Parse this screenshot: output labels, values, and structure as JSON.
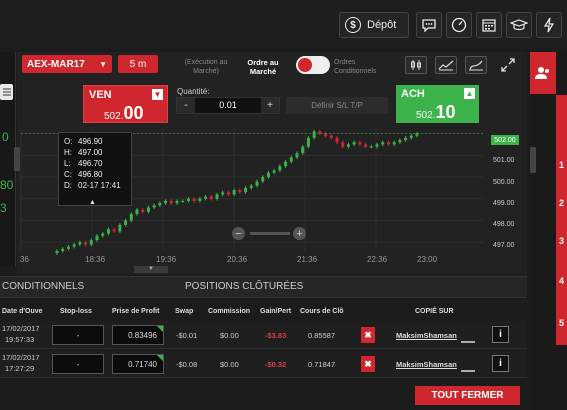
{
  "topbar": {
    "deposit_label": "Dépôt",
    "icons": [
      "chat-icon",
      "gauge-icon",
      "calendar-icon",
      "graduation-cap-icon",
      "lightning-icon"
    ]
  },
  "left_strip": {
    "numbers": [
      "0",
      "80",
      "3"
    ]
  },
  "chart_toolbar": {
    "symbol": "AEX-MAR17",
    "timeframe": "5 m",
    "exec_market_label": "(Exécution au Marché)",
    "market_order_label": "Ordre au Marché",
    "conditional_orders_label": "Ordres Conditionnels"
  },
  "trade": {
    "sell_label": "VEN",
    "sell_price_main": "502.",
    "sell_price_big": "00",
    "buy_label": "ACH",
    "buy_price_main": "502.",
    "buy_price_big": "10",
    "quantity_label": "Quantité:",
    "quantity_value": "0.01",
    "minus": "-",
    "plus": "+",
    "sltp_label": "Définir S/L T/P"
  },
  "tooltip": {
    "o_label": "O:",
    "o": "496.90",
    "h_label": "H:",
    "h": "497.00",
    "l_label": "L:",
    "l": "496.70",
    "c_label": "C:",
    "c": "496.80",
    "d_label": "D:",
    "d": "02-17 17:41"
  },
  "chart_data": {
    "type": "candlestick",
    "x_ticks": [
      "18:36",
      "19:36",
      "20:36",
      "21:36",
      "22:36",
      "23:00"
    ],
    "x_tick_first_partial": "36",
    "y_ticks": [
      "502.00",
      "501.00",
      "500.00",
      "499.00",
      "498.00",
      "497.00"
    ],
    "current_price": "502.00",
    "ylim": [
      496.6,
      502.3
    ],
    "colors": {
      "up": "#3cb34a",
      "down": "#d0262d"
    },
    "close_series": [
      496.6,
      496.7,
      496.8,
      496.9,
      497.0,
      496.9,
      497.1,
      497.3,
      497.4,
      497.6,
      497.5,
      497.8,
      498.0,
      498.3,
      498.5,
      498.4,
      498.6,
      498.7,
      498.8,
      498.9,
      498.8,
      498.9,
      498.9,
      499.0,
      498.9,
      499.0,
      499.1,
      499.0,
      499.2,
      499.3,
      499.2,
      499.4,
      499.3,
      499.5,
      499.6,
      499.8,
      500.0,
      500.2,
      500.3,
      500.5,
      500.7,
      500.9,
      501.1,
      501.4,
      501.8,
      502.1,
      502.0,
      501.9,
      501.8,
      501.6,
      501.4,
      501.5,
      501.6,
      501.5,
      501.4,
      501.4,
      501.5,
      501.6,
      501.5,
      501.6,
      501.7,
      501.8,
      501.9,
      502.0
    ]
  },
  "tabs": {
    "open_conditional": "CONDITIONNELS",
    "closed_positions": "POSITIONS CLÔTURÉES"
  },
  "table": {
    "headers": [
      "Date d'Ouve",
      "Stop-loss",
      "Prise de Profit",
      "Swap",
      "Commission",
      "Gain/Pert",
      "Cours de Clô",
      "COPIÉ SUR"
    ],
    "rows": [
      {
        "date": "17/02/2017",
        "time": "19:57:33",
        "sl": "-",
        "tp": "0.83496",
        "swap": "-$0.01",
        "commission": "$0.00",
        "pl": "-$3.83",
        "close": "0.85587",
        "x": "✖",
        "user": "MaksimShamsan",
        "info": "i"
      },
      {
        "date": "17/02/2017",
        "time": "17:27:29",
        "sl": "-",
        "tp": "0.71740",
        "swap": "-$0.08",
        "commission": "$0.00",
        "pl": "-$0.32",
        "close": "0.71847",
        "x": "✖",
        "user": "MaksimShamsan",
        "info": "i"
      }
    ]
  },
  "close_all_label": "TOUT FERMER",
  "right_numbers": [
    "1",
    "2",
    "3",
    "4",
    "5"
  ]
}
